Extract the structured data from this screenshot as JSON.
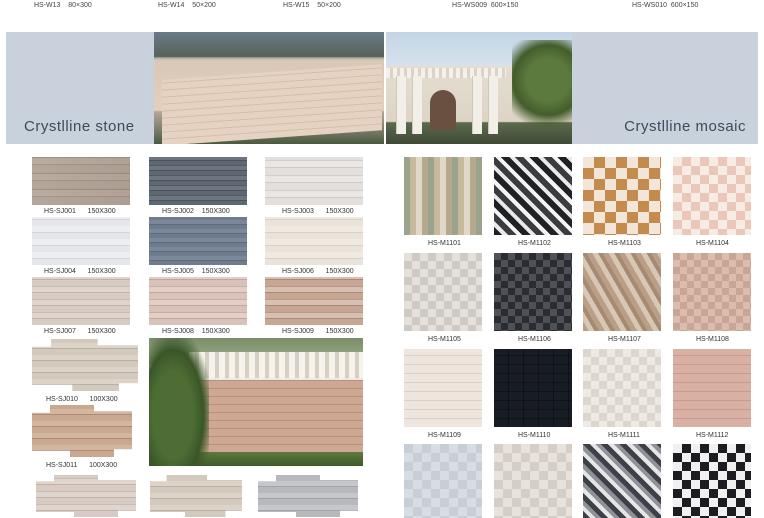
{
  "top_labels": [
    {
      "code": "HS-W13",
      "size": "80×300"
    },
    {
      "code": "HS-W14",
      "size": "50×200"
    },
    {
      "code": "HS-W15",
      "size": "50×200"
    },
    {
      "code": "HS-WS009",
      "size": "600×150"
    },
    {
      "code": "HS-WS010",
      "size": "600×150"
    }
  ],
  "sections": {
    "stone_title": "Crystlline stone",
    "mosaic_title": "Crystlline  mosaic"
  },
  "stone_tiles": [
    {
      "code": "HS-SJ001",
      "size": "150X300"
    },
    {
      "code": "HS-SJ002",
      "size": "150X300"
    },
    {
      "code": "HS-SJ003",
      "size": "150X300"
    },
    {
      "code": "HS-SJ004",
      "size": "150X300"
    },
    {
      "code": "HS-SJ005",
      "size": "150X300"
    },
    {
      "code": "HS-SJ006",
      "size": "150X300"
    },
    {
      "code": "HS-SJ007",
      "size": "150X300"
    },
    {
      "code": "HS-SJ008",
      "size": "150X300"
    },
    {
      "code": "HS-SJ009",
      "size": "150X300"
    },
    {
      "code": "HS-SJ010",
      "size": "100X300"
    },
    {
      "code": "HS-SJ011",
      "size": "100X300"
    }
  ],
  "mosaic_tiles": [
    {
      "code": "HS-M1101"
    },
    {
      "code": "HS-M1102"
    },
    {
      "code": "HS-M1103"
    },
    {
      "code": "HS-M1104"
    },
    {
      "code": "HS-M1105"
    },
    {
      "code": "HS-M1106"
    },
    {
      "code": "HS-M1107"
    },
    {
      "code": "HS-M1108"
    },
    {
      "code": "HS-M1109"
    },
    {
      "code": "HS-M1110"
    },
    {
      "code": "HS-M1111"
    },
    {
      "code": "HS-M1112"
    }
  ],
  "colors": {
    "banner": "#c9d2dc",
    "banner_text": "#3c4a5a"
  }
}
